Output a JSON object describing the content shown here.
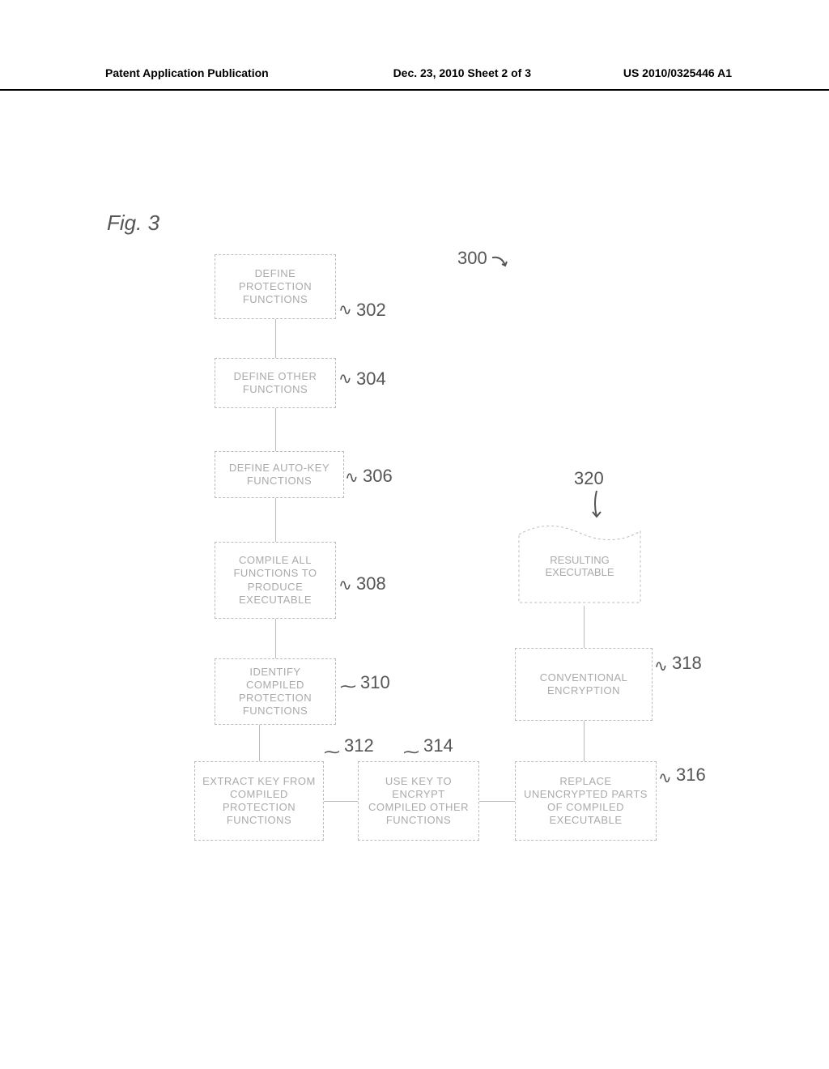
{
  "header": {
    "left": "Patent Application Publication",
    "mid": "Dec. 23, 2010  Sheet 2 of 3",
    "right": "US 2010/0325446 A1"
  },
  "figure_label": "Fig. 3",
  "refs": {
    "r300": "300",
    "r302": "302",
    "r304": "304",
    "r306": "306",
    "r308": "308",
    "r310": "310",
    "r312": "312",
    "r314": "314",
    "r316": "316",
    "r318": "318",
    "r320": "320"
  },
  "boxes": {
    "b302": "DEFINE PROTECTION FUNCTIONS",
    "b304": "DEFINE OTHER FUNCTIONS",
    "b306": "DEFINE AUTO-KEY FUNCTIONS",
    "b308": "COMPILE ALL FUNCTIONS TO PRODUCE EXECUTABLE",
    "b310": "IDENTIFY COMPILED PROTECTION FUNCTIONS",
    "b312": "EXTRACT KEY FROM COMPILED PROTECTION FUNCTIONS",
    "b314": "USE KEY TO ENCRYPT COMPILED OTHER FUNCTIONS",
    "b316": "REPLACE UNENCRYPTED PARTS OF COMPILED EXECUTABLE",
    "b318": "CONVENTIONAL ENCRYPTION",
    "d320": "RESULTING EXECUTABLE"
  }
}
